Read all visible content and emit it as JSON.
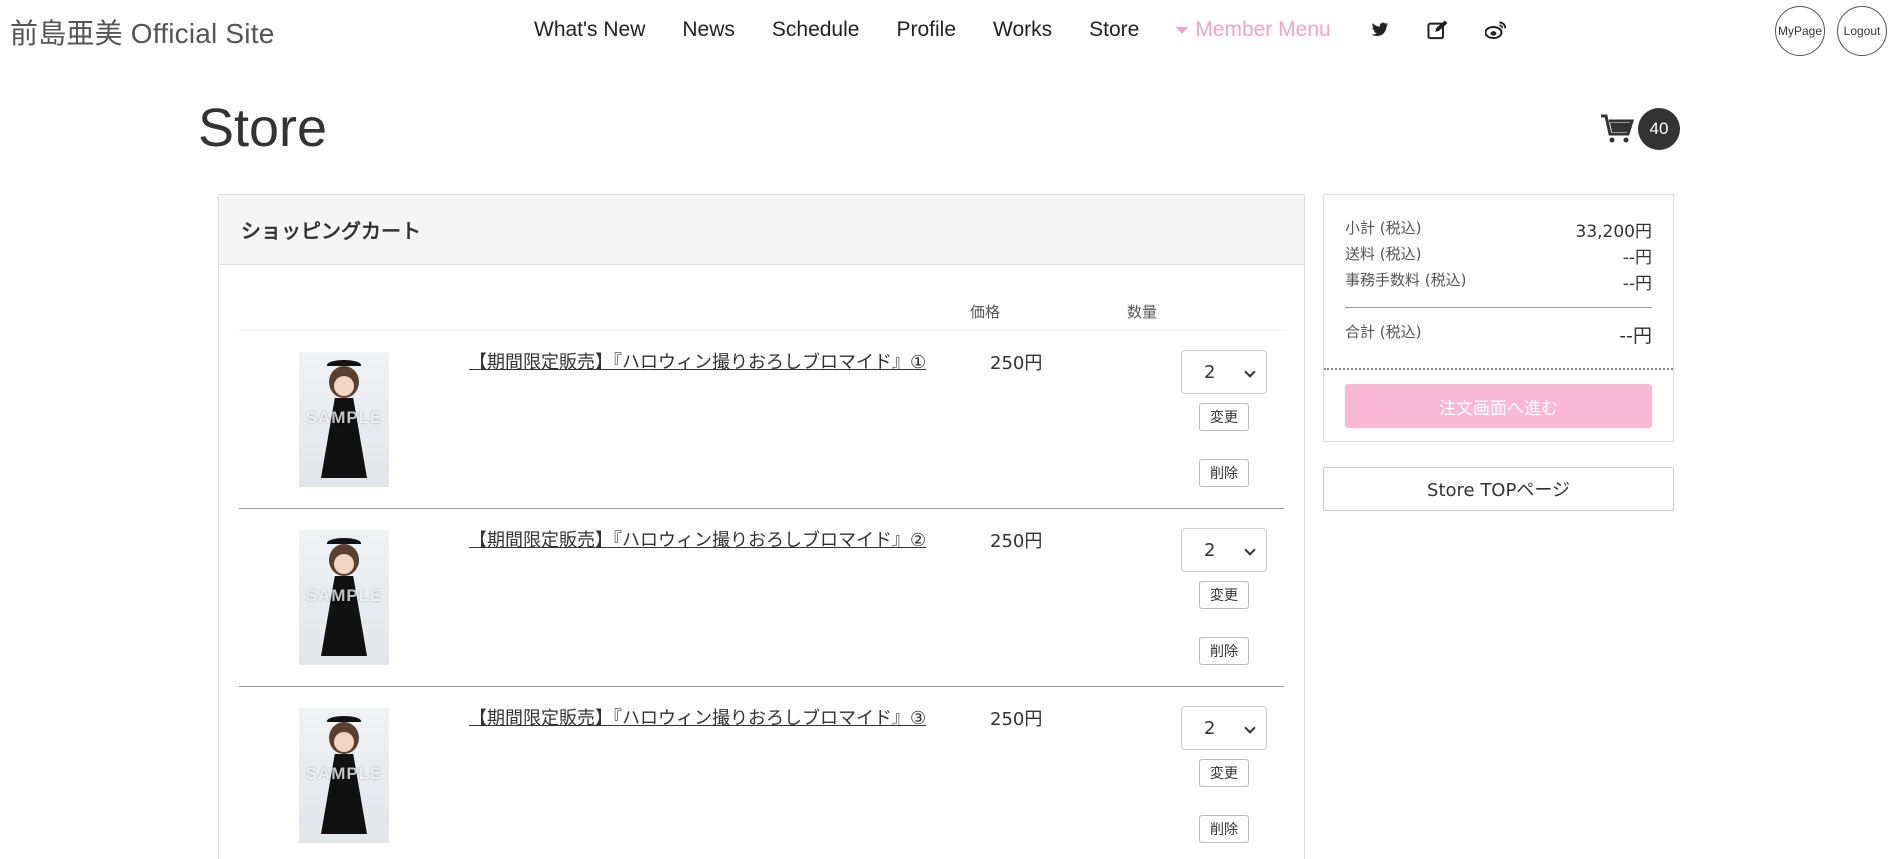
{
  "header": {
    "site_title": "前島亜美 Official Site",
    "nav": [
      "What's New",
      "News",
      "Schedule",
      "Profile",
      "Works",
      "Store"
    ],
    "member_menu": "Member Menu",
    "mypage": "MyPage",
    "logout": "Logout"
  },
  "page": {
    "title": "Store",
    "cart_count": "40"
  },
  "cart": {
    "heading": "ショッピングカート",
    "col_price": "価格",
    "col_qty": "数量",
    "change_label": "変更",
    "delete_label": "削除",
    "items": [
      {
        "title": "【期間限定販売】『ハロウィン撮りおろしブロマイド』①",
        "price": "250円",
        "qty": "2",
        "watermark": "SAMPLE"
      },
      {
        "title": "【期間限定販売】『ハロウィン撮りおろしブロマイド』②",
        "price": "250円",
        "qty": "2",
        "watermark": "SAMPLE"
      },
      {
        "title": "【期間限定販売】『ハロウィン撮りおろしブロマイド』③",
        "price": "250円",
        "qty": "2",
        "watermark": "SAMPLE"
      }
    ]
  },
  "summary": {
    "subtotal_label": "小計 (税込)",
    "subtotal_value": "33,200円",
    "shipping_label": "送料 (税込)",
    "shipping_value": "--円",
    "fee_label": "事務手数料 (税込)",
    "fee_value": "--円",
    "total_label": "合計 (税込)",
    "total_value": "--円",
    "order_button": "注文画面へ進む",
    "store_top": "Store TOPページ"
  },
  "colors": {
    "accent_pink": "#f5a3c7",
    "order_button": "#f9b8d3"
  }
}
